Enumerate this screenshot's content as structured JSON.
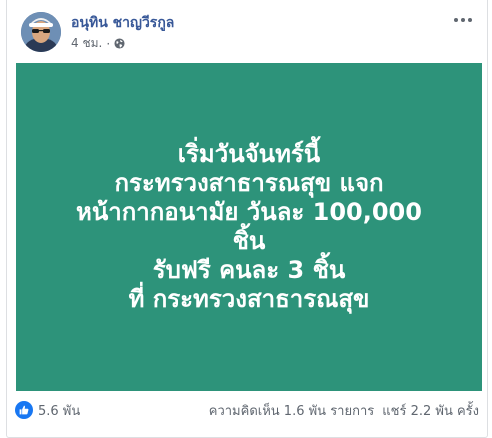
{
  "post": {
    "author": "อนุทิน ชาญวีรกูล",
    "time": "4 ชม.",
    "separator": "·",
    "privacy_icon": "globe-icon",
    "menu_icon": "more-options-icon",
    "image_lines": [
      "เริ่มวันจันทร์นี้",
      "กระทรวงสาธารณสุข แจก",
      "หน้ากากอนามัย วันละ 100,000",
      "ชิ้น",
      "รับฟรี คนละ 3 ชิ้น",
      "ที่ กระทรวงสาธารณสุข"
    ],
    "image_bg_color": "#2d937a"
  },
  "footer": {
    "reaction_icon": "like-icon",
    "reactions": "5.6 พัน",
    "comments": "ความคิดเห็น 1.6 พัน รายการ",
    "shares": "แชร์ 2.2 พัน ครั้ง"
  },
  "colors": {
    "author_link": "#385898",
    "like_blue": "#1877f2"
  }
}
